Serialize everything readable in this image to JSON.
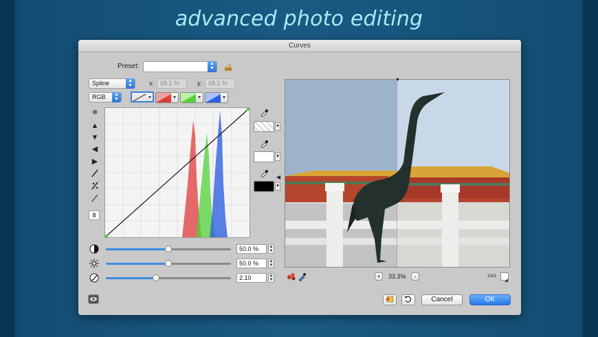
{
  "headline": "advanced photo editing",
  "dialog": {
    "title": "Curves",
    "preset_label": "Preset:",
    "preset_value": "",
    "mode": "Spline",
    "x_label": "x:",
    "x_value": "68.1 %",
    "y_label": "y:",
    "y_value": "68.1 %",
    "channel": "RGB",
    "point_count": "8",
    "sliders": [
      {
        "name": "contrast",
        "icon": "contrast-icon",
        "value_text": "50.0 %",
        "fraction": 0.5
      },
      {
        "name": "brightness",
        "icon": "sun-icon",
        "value_text": "50.0 %",
        "fraction": 0.5
      },
      {
        "name": "gamma",
        "icon": "gamma-icon",
        "value_text": "2.10",
        "fraction": 0.4
      }
    ],
    "zoom_in": "+",
    "zoom_value": "33.3%",
    "zoom_out": "-",
    "ratio_label": "1001",
    "cancel_label": "Cancel",
    "ok_label": "OK",
    "colors": {
      "accent": "#3f8be0",
      "red_hist": "#e23b3b",
      "green_hist": "#52d23a",
      "blue_hist": "#2f62e0"
    }
  }
}
